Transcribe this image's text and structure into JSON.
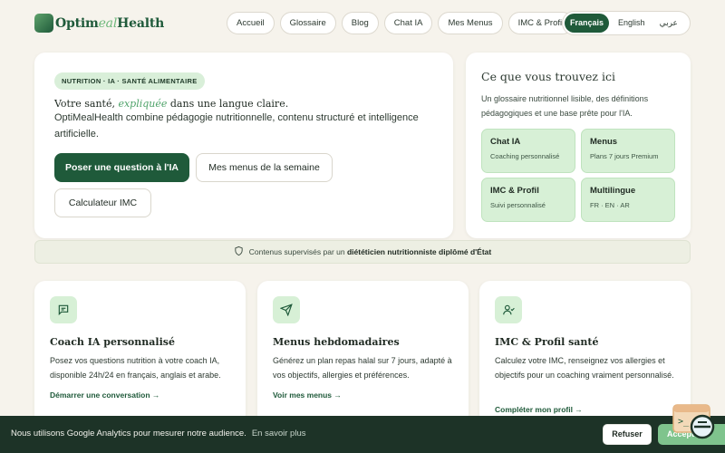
{
  "header": {
    "logo": {
      "part1": "Optim",
      "part2": "eal",
      "part3": "Health"
    },
    "nav": [
      "Accueil",
      "Glossaire",
      "Blog",
      "Chat IA",
      "Mes Menus",
      "IMC & Profil"
    ],
    "languages": {
      "fr": "Français",
      "en": "English",
      "ar": "عربي"
    }
  },
  "hero": {
    "badge": "NUTRITION · IA · SANTÉ ALIMENTAIRE",
    "line1_start": "Votre santé, ",
    "line1_em": "expliquée",
    "line1_end": " dans une langue claire.",
    "line2": "OptiMealHealth combine pédagogie nutritionnelle, contenu structuré et intelligence artificielle.",
    "btn_ask": "Poser une question à l'IA",
    "btn_menus": "Mes menus de la semaine",
    "btn_bmi": "Calculateur IMC"
  },
  "side": {
    "title": "Ce que vous trouvez ici",
    "desc": "Un glossaire nutritionnel lisible, des définitions pédagogiques et une base prête pour l'IA.",
    "tiles": [
      {
        "title": "Chat IA",
        "sub": "Coaching personnalisé"
      },
      {
        "title": "Menus",
        "sub": "Plans 7 jours Premium"
      },
      {
        "title": "IMC & Profil",
        "sub": "Suivi personnalisé"
      },
      {
        "title": "Multilingue",
        "sub": "FR · EN · AR"
      }
    ]
  },
  "supervision": {
    "text": "Contenus supervisés par un ",
    "bold": "diététicien nutritionniste diplômé d'État"
  },
  "features": [
    {
      "title": "Coach IA personnalisé",
      "desc": "Posez vos questions nutrition à votre coach IA, disponible 24h/24 en français, anglais et arabe.",
      "link": "Démarrer une conversation →"
    },
    {
      "title": "Menus hebdomadaires",
      "desc": "Générez un plan repas halal sur 7 jours, adapté à vos objectifs, allergies et préférences.",
      "link": "Voir mes menus →"
    },
    {
      "title": "IMC & Profil santé",
      "desc": "Calculez votre IMC, renseignez vos allergies et objectifs pour un coaching vraiment personnalisé.",
      "link": "Compléter mon profil →"
    }
  ],
  "cookie": {
    "text": "Nous utilisons Google Analytics pour mesurer notre audience.",
    "link": "En savoir plus",
    "refuse": "Refuser",
    "accept": "Accepter"
  },
  "colors": {
    "brand": "#1f5a3a",
    "accent": "#6fb97c",
    "tile": "#d7f0d6",
    "background": "#f6f3ec"
  },
  "icons": [
    "message-square-icon",
    "send-icon",
    "user-profile-icon",
    "shield-icon",
    "chat-widget-icon"
  ]
}
